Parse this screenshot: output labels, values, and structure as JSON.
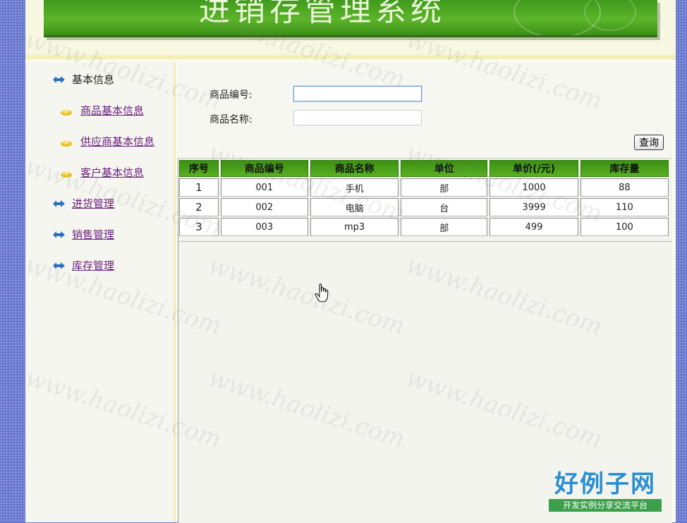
{
  "header": {
    "title": "进销存管理系统"
  },
  "nav": {
    "groups": [
      {
        "label": "基本信息",
        "children": [
          {
            "label": "商品基本信息"
          },
          {
            "label": "供应商基本信息"
          },
          {
            "label": "客户基本信息"
          }
        ]
      },
      {
        "label": "进货管理"
      },
      {
        "label": "销售管理"
      },
      {
        "label": "库存管理"
      }
    ]
  },
  "search": {
    "code_label": "商品编号:",
    "code_value": "",
    "name_label": "商品名称:",
    "name_value": "",
    "query_label": "查询"
  },
  "table": {
    "columns": [
      "序号",
      "商品编号",
      "商品名称",
      "单位",
      "单价(/元)",
      "库存量"
    ],
    "rows": [
      [
        "1",
        "001",
        "手机",
        "部",
        "1000",
        "88"
      ],
      [
        "2",
        "002",
        "电脑",
        "台",
        "3999",
        "110"
      ],
      [
        "3",
        "003",
        "mp3",
        "部",
        "499",
        "100"
      ]
    ]
  },
  "watermark": {
    "text": "www.haolizi.com",
    "brand_name": "好例子网",
    "brand_slogan": "开发实例分享交流平台"
  },
  "colors": {
    "banner_green": "#4ea622",
    "header_green": "#3b8f12",
    "link_purple": "#6b1e7e",
    "side_blue": "#6675cc"
  }
}
